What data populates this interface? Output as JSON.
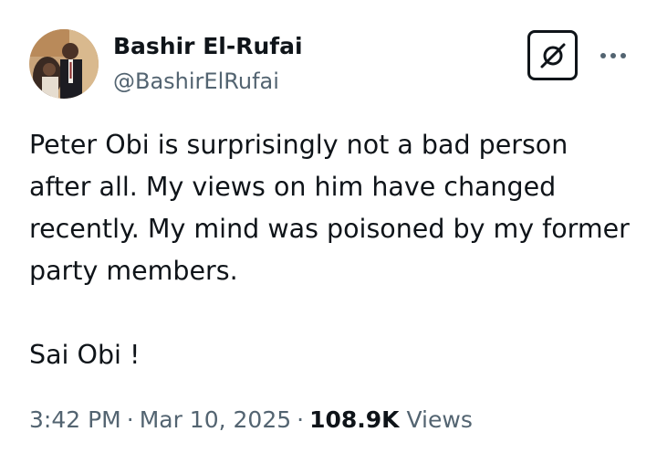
{
  "author": {
    "display_name": "Bashir El-Rufai",
    "handle": "@BashirElRufai",
    "avatar_icon": "profile-photo"
  },
  "actions": {
    "grok_icon": "grok-icon",
    "more_icon": "more-dots-icon"
  },
  "tweet": {
    "paragraph_1": "Peter Obi is surprisingly not a bad person after all. My views on him have changed recently. My mind was poisoned by my former party members.",
    "paragraph_2": "Sai Obi !"
  },
  "meta": {
    "time": "3:42 PM",
    "separator": "·",
    "date": "Mar 10, 2025",
    "views_count": "108.9K",
    "views_label": "Views"
  },
  "colors": {
    "text_primary": "#0f1419",
    "text_secondary": "#536471",
    "background": "#ffffff"
  }
}
